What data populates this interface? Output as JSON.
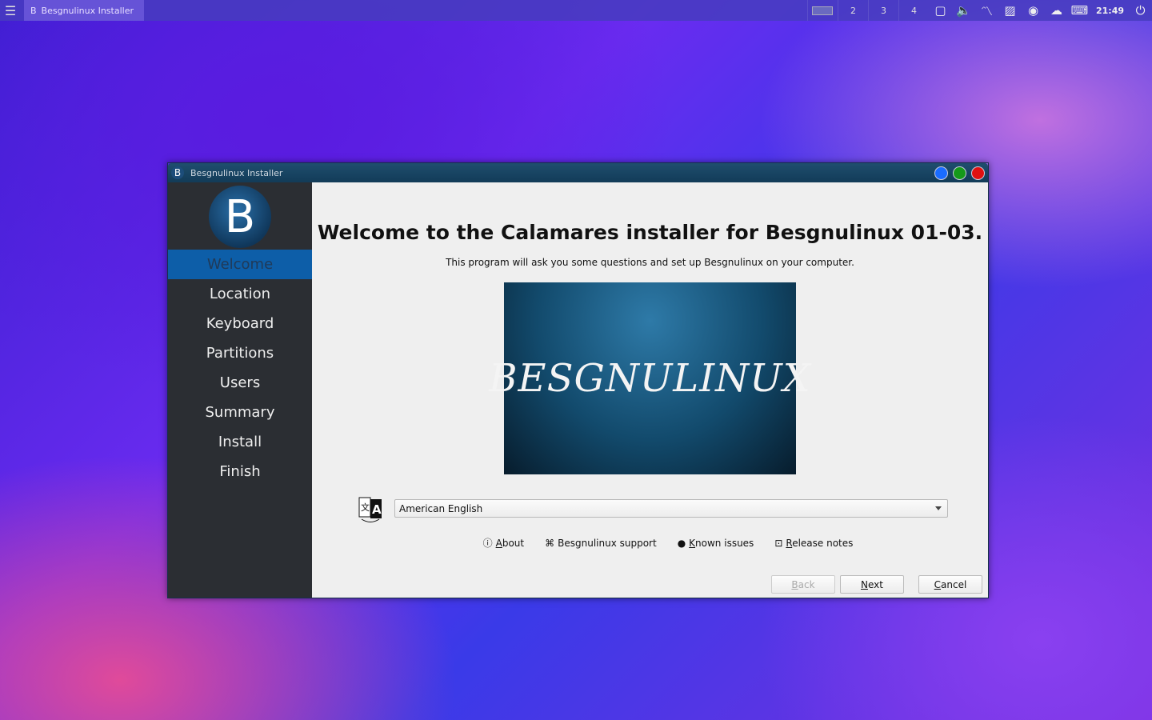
{
  "taskbar": {
    "menu_icon": "hamburger-icon",
    "task_label": "Besgnulinux Installer",
    "workspaces": [
      "2",
      "3",
      "4"
    ],
    "clock": "21:49",
    "tray_icons": [
      "window-icon",
      "volume-icon",
      "monitor-icon",
      "image-icon",
      "record-icon",
      "weather-icon",
      "keyboard-icon"
    ]
  },
  "window": {
    "title": "Besgnulinux Installer",
    "controls": {
      "minimize": "#1a6cff",
      "maximize": "#15991a",
      "close": "#e01010"
    }
  },
  "sidebar": {
    "logo_letter": "B",
    "steps": [
      "Welcome",
      "Location",
      "Keyboard",
      "Partitions",
      "Users",
      "Summary",
      "Install",
      "Finish"
    ],
    "active_step": "Welcome"
  },
  "main": {
    "title": "Welcome to the Calamares installer for Besgnulinux 01-03.",
    "subtitle": "This program will ask you some questions and set up Besgnulinux on your computer.",
    "banner_text": "BESGNULINUX",
    "language_value": "American English",
    "links": [
      {
        "k": "A",
        "rest": "bout",
        "icon": "info-icon"
      },
      {
        "k": "",
        "rest": "Besgnulinux support",
        "icon": "support-icon"
      },
      {
        "k": "K",
        "rest": "nown issues",
        "icon": "bug-icon"
      },
      {
        "k": "R",
        "rest": "elease notes",
        "icon": "notes-icon"
      }
    ],
    "buttons": {
      "back_k": "B",
      "back_rest": "ack",
      "next_k": "N",
      "next_rest": "ext",
      "cancel_k": "C",
      "cancel_rest": "ancel"
    }
  }
}
